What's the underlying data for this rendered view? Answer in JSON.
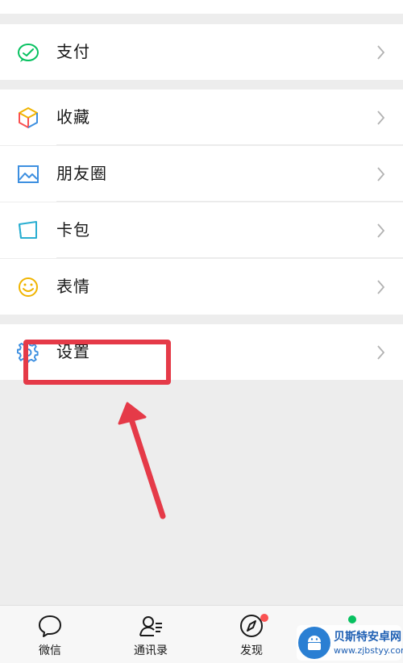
{
  "menu": {
    "pay": "支付",
    "favorites": "收藏",
    "moments": "朋友圈",
    "cards": "卡包",
    "stickers": "表情",
    "settings": "设置"
  },
  "tabbar": {
    "chats": "微信",
    "contacts": "通讯录",
    "discover": "发现"
  },
  "colors": {
    "pay_green": "#07c160",
    "highlight_red": "#e53a48",
    "badge_red": "#fa5151",
    "badge_green": "#07c160"
  },
  "watermark": {
    "title": "贝斯特安卓网",
    "url": "www.zjbstyy.com"
  }
}
